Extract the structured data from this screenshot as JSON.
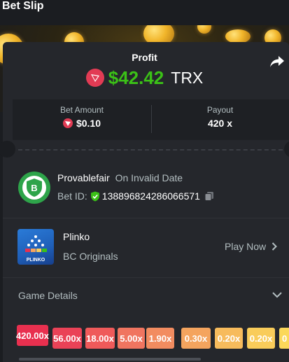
{
  "header": {
    "title": "Bet Slip"
  },
  "profit": {
    "label": "Profit",
    "amount": "$42.42",
    "currency": "TRX"
  },
  "bet": {
    "amount_label": "Bet Amount",
    "amount_value": "$0.10",
    "payout_label": "Payout",
    "payout_value": "420 x"
  },
  "provably": {
    "name": "Provablefair",
    "date": "On Invalid Date",
    "bet_id_label": "Bet ID:",
    "bet_id": "138896824286066571"
  },
  "game": {
    "name": "Plinko",
    "provider": "BC Originals",
    "play_label": "Play Now",
    "thumb_text": "PLINKO"
  },
  "details": {
    "label": "Game Details"
  },
  "multipliers": [
    "420.00x",
    "56.00x",
    "18.00x",
    "5.00x",
    "1.90x",
    "0.30x",
    "0.20x",
    "0.20x",
    "0"
  ],
  "colors": {
    "profit_green": "#3bc117",
    "trx_red": "#e23b54",
    "shield_green": "#2ea44a",
    "multiplier_gradient": [
      "#e8304f",
      "#ea4257",
      "#ef5a5a",
      "#f07560",
      "#f28c60",
      "#f4a45e",
      "#f7bb5c",
      "#f9cc5a",
      "#fbd85a"
    ]
  }
}
